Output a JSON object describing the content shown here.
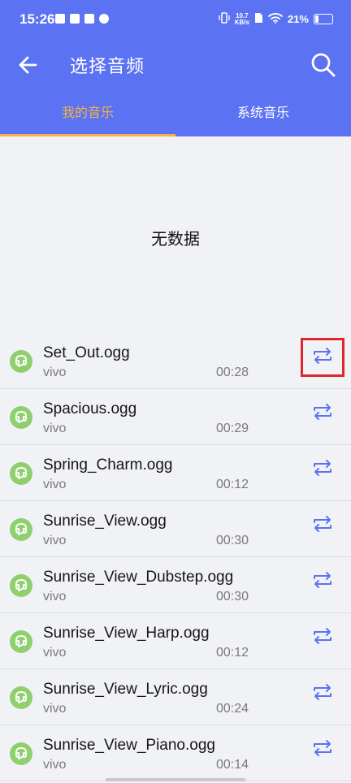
{
  "status": {
    "time": "15:26",
    "net_speed_top": "10.7",
    "net_speed_bottom": "KB/s",
    "battery": "21%"
  },
  "header": {
    "title": "选择音频"
  },
  "tabs": [
    {
      "label": "我的音乐",
      "active": true
    },
    {
      "label": "系统音乐",
      "active": false
    }
  ],
  "empty_message": "无数据",
  "songs": [
    {
      "title": "Set_Out.ogg",
      "artist": "vivo",
      "duration": "00:28"
    },
    {
      "title": "Spacious.ogg",
      "artist": "vivo",
      "duration": "00:29"
    },
    {
      "title": "Spring_Charm.ogg",
      "artist": "vivo",
      "duration": "00:12"
    },
    {
      "title": "Sunrise_View.ogg",
      "artist": "vivo",
      "duration": "00:30"
    },
    {
      "title": "Sunrise_View_Dubstep.ogg",
      "artist": "vivo",
      "duration": "00:30"
    },
    {
      "title": "Sunrise_View_Harp.ogg",
      "artist": "vivo",
      "duration": "00:12"
    },
    {
      "title": "Sunrise_View_Lyric.ogg",
      "artist": "vivo",
      "duration": "00:24"
    },
    {
      "title": "Sunrise_View_Piano.ogg",
      "artist": "vivo",
      "duration": "00:14"
    }
  ],
  "colors": {
    "primary": "#5b73f2",
    "active_tab": "#f5b342",
    "song_icon": "#8fcf6e",
    "repeat_icon": "#5b73f2",
    "highlight": "#e0262b"
  }
}
